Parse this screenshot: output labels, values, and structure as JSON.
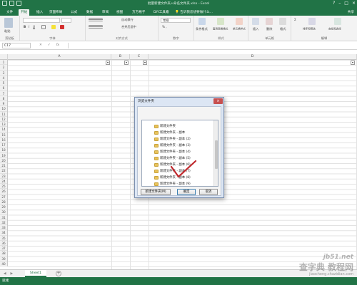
{
  "window": {
    "title": "批量新建文件夹+命名文件夹.xlsx - Excel",
    "controls": [
      "?",
      "–",
      "□",
      "×"
    ]
  },
  "ribbon": {
    "tabs": [
      "文件",
      "开始",
      "插入",
      "页面布局",
      "公式",
      "数据",
      "审阅",
      "视图",
      "方方格子",
      "DIY工具箱"
    ],
    "active_tab": "开始",
    "tell_me": "告诉我您想要做什么...",
    "share": "共享",
    "groups": {
      "clipboard": "剪贴板",
      "font": "字体",
      "alignment": "对齐方式",
      "number": "数字",
      "styles": "样式",
      "cells": "单元格",
      "editing": "编辑"
    },
    "items": {
      "paste": "粘贴",
      "wrap_text": "自动换行",
      "merge_center": "合并后居中",
      "number_format": "常规",
      "conditional": "条件格式",
      "table_format": "套用表格格式",
      "cell_styles": "单元格样式",
      "insert": "插入",
      "delete": "删除",
      "format": "格式",
      "sort_filter": "排序和筛选",
      "find_select": "查找和选择"
    }
  },
  "formula_bar": {
    "name_box": "C17",
    "fx": "fx",
    "cancel": "✕",
    "enter": "✓"
  },
  "grid": {
    "columns": [
      "A",
      "B",
      "C",
      "D"
    ],
    "rows": [
      "1",
      "2",
      "3",
      "4",
      "5",
      "6",
      "7",
      "8",
      "9",
      "10",
      "11",
      "12",
      "13",
      "14",
      "15",
      "16",
      "17",
      "18",
      "19",
      "20",
      "21",
      "22",
      "23",
      "24",
      "25",
      "26",
      "27",
      "28",
      "29",
      "30",
      "31",
      "32",
      "33",
      "34",
      "35",
      "36",
      "37",
      "38",
      "39",
      "40"
    ],
    "filter_glyph": "▾"
  },
  "sheets": {
    "tabs": [
      "Sheet1"
    ],
    "add": "+",
    "nav": [
      "◀",
      "▶"
    ]
  },
  "status": {
    "text": "就绪"
  },
  "dialog": {
    "title": "浏览文件夹",
    "close": "×",
    "hint": "",
    "folders": [
      "新建文件夹",
      "新建文件夹 - 副本",
      "新建文件夹 - 副本 (2)",
      "新建文件夹 - 副本 (3)",
      "新建文件夹 - 副本 (4)",
      "新建文件夹 - 副本 (5)",
      "新建文件夹 - 副本 (6)",
      "新建文件夹 - 副本 (7)",
      "新建文件夹 - 副本 (8)",
      "新建文件夹 - 副本 (9)"
    ],
    "buttons": {
      "new_folder": "新建文件夹(M)",
      "ok": "确定",
      "cancel": "取消"
    }
  },
  "watermark": {
    "line1": "jb51.net",
    "line2": "查字典 教程网",
    "line3": "jiaocheng.chazidian.com"
  },
  "colors": {
    "excel_green": "#217346",
    "dialog_bg": "#dce6f4",
    "check_red": "#c0282d",
    "folder_yellow": "#e8c25a"
  }
}
